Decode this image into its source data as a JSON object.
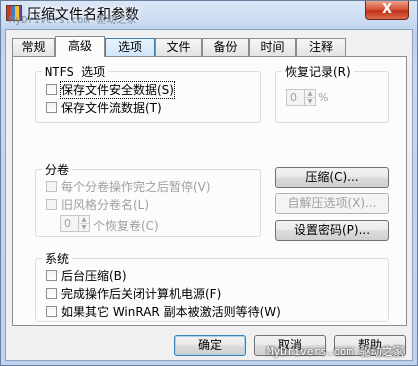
{
  "window": {
    "title": "压缩文件名和参数",
    "close_label": "X",
    "watermark_top": "MyDrivers.com 驱动之家"
  },
  "tabs": [
    {
      "label": "常规"
    },
    {
      "label": "高级"
    },
    {
      "label": "选项"
    },
    {
      "label": "文件"
    },
    {
      "label": "备份"
    },
    {
      "label": "时间"
    },
    {
      "label": "注释"
    }
  ],
  "ntfs": {
    "title": "NTFS 选项",
    "items": [
      {
        "label": "保存文件安全数据(S)",
        "checked": false
      },
      {
        "label": "保存文件流数据(T)",
        "checked": false
      }
    ]
  },
  "recovery": {
    "title": "恢复记录(R)",
    "value": "0",
    "unit": "%"
  },
  "volumes": {
    "title": "分卷",
    "items": [
      {
        "label": "每个分卷操作完之后暂停(V)",
        "checked": false
      },
      {
        "label": "旧风格分卷名(L)",
        "checked": false
      }
    ],
    "recovery_volumes_value": "0",
    "recovery_volumes_label": "个恢复卷(C)"
  },
  "buttons": {
    "compression": "压缩(C)...",
    "sfx_options": "自解压选项(X)...",
    "set_password": "设置密码(P)...",
    "ok": "确定",
    "cancel": "取消",
    "help": "帮助"
  },
  "system": {
    "title": "系统",
    "items": [
      {
        "label": "后台压缩(B)",
        "checked": false
      },
      {
        "label": "完成操作后关闭计算机电源(F)",
        "checked": false
      },
      {
        "label": "如果其它 WinRAR 副本被激活则等待(W)",
        "checked": false
      }
    ]
  },
  "watermark_bottom": "MyDrivers.com 驱动之家",
  "colors": {
    "title_gradient_top": "#dbe7f7",
    "dialog_bg": "#f0f0f0",
    "panel_bg": "#fcfcfc",
    "close_red": "#c0311a",
    "focus_blue": "#3c7fb1",
    "disabled_text": "#a0a0a0"
  }
}
